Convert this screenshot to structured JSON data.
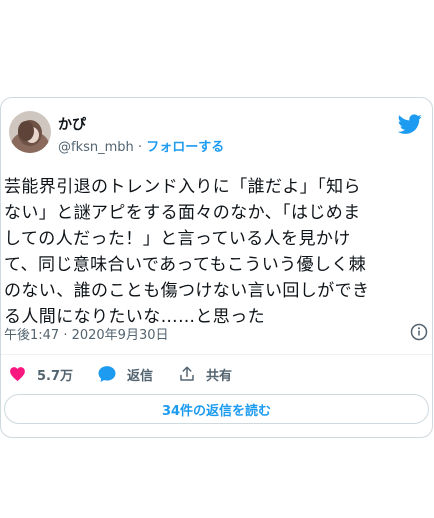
{
  "tweet": {
    "author": {
      "display_name": "かぴ",
      "handle": "@fksn_mbh",
      "separator": "·",
      "follow_label": "フォローする"
    },
    "text_lines": [
      "芸能界引退のトレンド入りに「誰だよ」「知ら",
      "ない」と謎アピをする面々のなか、「はじめま",
      "しての人だった！」と言っている人を見かけ",
      "て、同じ意味合いであってもこういう優しく棘",
      "のない、誰のことも傷つけない言い回しができ",
      "る人間になりたいな……と思った"
    ],
    "timestamp": "午後1:47 · 2020年9月30日",
    "actions": {
      "like_count": "5.7万",
      "reply_label": "返信",
      "share_label": "共有"
    },
    "read_replies_label": "34件の返信を読む"
  },
  "colors": {
    "accent": "#1d9bf0",
    "like": "#f91880",
    "secondary_text": "#536471",
    "border": "#cfd9de"
  },
  "icons": {
    "brand": "twitter-bird-icon",
    "like": "heart-icon",
    "reply": "speech-bubble-icon",
    "share": "share-arrow-icon",
    "info": "info-icon"
  }
}
